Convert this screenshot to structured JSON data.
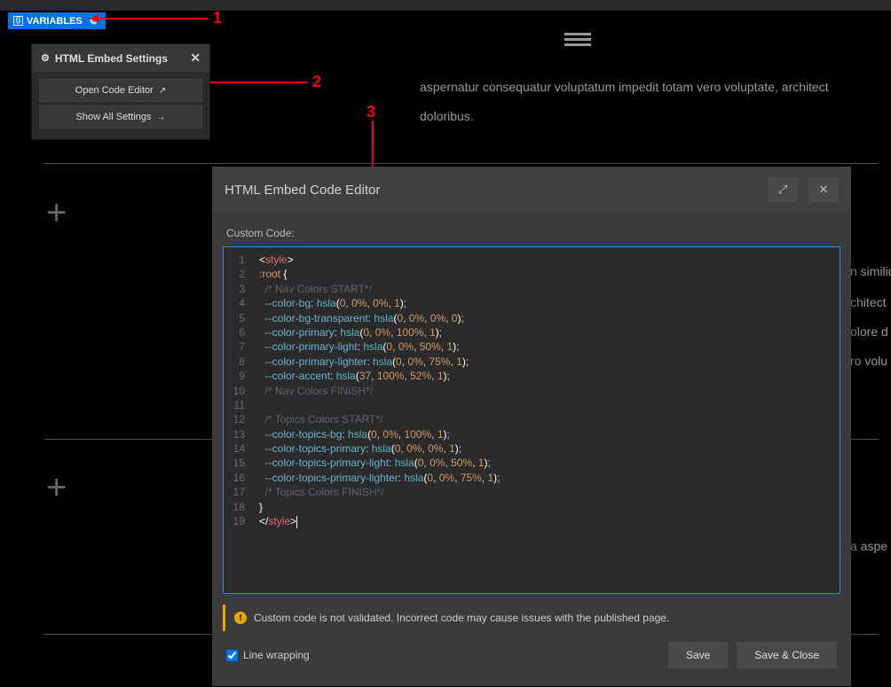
{
  "variables": {
    "label": "VARIABLES"
  },
  "annotations": {
    "n1": "1",
    "n2": "2",
    "n3": "3"
  },
  "settings": {
    "title": "HTML Embed Settings",
    "open_code": "Open Code Editor",
    "show_all": "Show All Settings"
  },
  "bg": {
    "line1": "aspernatur consequatur voluptatum impedit totam vero voluptate, architect",
    "line2": "doloribus.",
    "line3": "n similiq",
    "line4": "chitect",
    "line5": "olore d",
    "line6": "ro volu",
    "line7": "a aspe"
  },
  "editor": {
    "title": "HTML Embed Code Editor",
    "custom_label": "Custom Code:",
    "warning": "Custom code is not validated. Incorrect code may cause issues with the published page.",
    "line_wrap": "Line wrapping",
    "save": "Save",
    "save_close": "Save & Close",
    "lines": [
      {
        "n": 1,
        "tokens": [
          [
            "bracket",
            "<"
          ],
          [
            "tag",
            "style"
          ],
          [
            "bracket",
            ">"
          ]
        ]
      },
      {
        "n": 2,
        "tokens": [
          [
            "sel",
            ":root "
          ],
          [
            "bracket",
            "{"
          ]
        ]
      },
      {
        "n": 3,
        "tokens": [
          [
            "plain",
            "  "
          ],
          [
            "comment",
            "/* Nav Colors START*/"
          ]
        ]
      },
      {
        "n": 4,
        "tokens": [
          [
            "plain",
            "  "
          ],
          [
            "var",
            "--color-bg"
          ],
          [
            "plain",
            ": "
          ],
          [
            "func",
            "hsla"
          ],
          [
            "bracket",
            "("
          ],
          [
            "num",
            "0"
          ],
          [
            "plain",
            ", "
          ],
          [
            "num",
            "0%"
          ],
          [
            "plain",
            ", "
          ],
          [
            "num",
            "0%"
          ],
          [
            "plain",
            ", "
          ],
          [
            "num",
            "1"
          ],
          [
            "bracket",
            ")"
          ],
          [
            "plain",
            ";"
          ]
        ]
      },
      {
        "n": 5,
        "tokens": [
          [
            "plain",
            "  "
          ],
          [
            "var",
            "--color-bg-transparent"
          ],
          [
            "plain",
            ": "
          ],
          [
            "func",
            "hsla"
          ],
          [
            "bracket",
            "("
          ],
          [
            "num",
            "0"
          ],
          [
            "plain",
            ", "
          ],
          [
            "num",
            "0%"
          ],
          [
            "plain",
            ", "
          ],
          [
            "num",
            "0%"
          ],
          [
            "plain",
            ", "
          ],
          [
            "num",
            "0"
          ],
          [
            "bracket",
            ")"
          ],
          [
            "plain",
            ";"
          ]
        ]
      },
      {
        "n": 6,
        "tokens": [
          [
            "plain",
            "  "
          ],
          [
            "var",
            "--color-primary"
          ],
          [
            "plain",
            ": "
          ],
          [
            "func",
            "hsla"
          ],
          [
            "bracket",
            "("
          ],
          [
            "num",
            "0"
          ],
          [
            "plain",
            ", "
          ],
          [
            "num",
            "0%"
          ],
          [
            "plain",
            ", "
          ],
          [
            "num",
            "100%"
          ],
          [
            "plain",
            ", "
          ],
          [
            "num",
            "1"
          ],
          [
            "bracket",
            ")"
          ],
          [
            "plain",
            ";"
          ]
        ]
      },
      {
        "n": 7,
        "tokens": [
          [
            "plain",
            "  "
          ],
          [
            "var",
            "--color-primary-light"
          ],
          [
            "plain",
            ": "
          ],
          [
            "func",
            "hsla"
          ],
          [
            "bracket",
            "("
          ],
          [
            "num",
            "0"
          ],
          [
            "plain",
            ", "
          ],
          [
            "num",
            "0%"
          ],
          [
            "plain",
            ", "
          ],
          [
            "num",
            "50%"
          ],
          [
            "plain",
            ", "
          ],
          [
            "num",
            "1"
          ],
          [
            "bracket",
            ")"
          ],
          [
            "plain",
            ";"
          ]
        ]
      },
      {
        "n": 8,
        "tokens": [
          [
            "plain",
            "  "
          ],
          [
            "var",
            "--color-primary-lighter"
          ],
          [
            "plain",
            ": "
          ],
          [
            "func",
            "hsla"
          ],
          [
            "bracket",
            "("
          ],
          [
            "num",
            "0"
          ],
          [
            "plain",
            ", "
          ],
          [
            "num",
            "0%"
          ],
          [
            "plain",
            ", "
          ],
          [
            "num",
            "75%"
          ],
          [
            "plain",
            ", "
          ],
          [
            "num",
            "1"
          ],
          [
            "bracket",
            ")"
          ],
          [
            "plain",
            ";"
          ]
        ]
      },
      {
        "n": 9,
        "tokens": [
          [
            "plain",
            "  "
          ],
          [
            "var",
            "--color-accent"
          ],
          [
            "plain",
            ": "
          ],
          [
            "func",
            "hsla"
          ],
          [
            "bracket",
            "("
          ],
          [
            "num",
            "37"
          ],
          [
            "plain",
            ", "
          ],
          [
            "num",
            "100%"
          ],
          [
            "plain",
            ", "
          ],
          [
            "num",
            "52%"
          ],
          [
            "plain",
            ", "
          ],
          [
            "num",
            "1"
          ],
          [
            "bracket",
            ")"
          ],
          [
            "plain",
            ";"
          ]
        ]
      },
      {
        "n": 10,
        "tokens": [
          [
            "plain",
            "  "
          ],
          [
            "comment",
            "/* Nav Colors FINISH*/"
          ]
        ]
      },
      {
        "n": 11,
        "tokens": []
      },
      {
        "n": 12,
        "tokens": [
          [
            "plain",
            "  "
          ],
          [
            "comment",
            "/* Topics Colors START*/"
          ]
        ]
      },
      {
        "n": 13,
        "tokens": [
          [
            "plain",
            "  "
          ],
          [
            "var",
            "--color-topics-bg"
          ],
          [
            "plain",
            ": "
          ],
          [
            "func",
            "hsla"
          ],
          [
            "bracket",
            "("
          ],
          [
            "num",
            "0"
          ],
          [
            "plain",
            ", "
          ],
          [
            "num",
            "0%"
          ],
          [
            "plain",
            ", "
          ],
          [
            "num",
            "100%"
          ],
          [
            "plain",
            ", "
          ],
          [
            "num",
            "1"
          ],
          [
            "bracket",
            ")"
          ],
          [
            "plain",
            ";"
          ]
        ]
      },
      {
        "n": 14,
        "tokens": [
          [
            "plain",
            "  "
          ],
          [
            "var",
            "--color-topics-primary"
          ],
          [
            "plain",
            ": "
          ],
          [
            "func",
            "hsla"
          ],
          [
            "bracket",
            "("
          ],
          [
            "num",
            "0"
          ],
          [
            "plain",
            ", "
          ],
          [
            "num",
            "0%"
          ],
          [
            "plain",
            ", "
          ],
          [
            "num",
            "0%"
          ],
          [
            "plain",
            ", "
          ],
          [
            "num",
            "1"
          ],
          [
            "bracket",
            ")"
          ],
          [
            "plain",
            ";"
          ]
        ]
      },
      {
        "n": 15,
        "tokens": [
          [
            "plain",
            "  "
          ],
          [
            "var",
            "--color-topics-primary-light"
          ],
          [
            "plain",
            ": "
          ],
          [
            "func",
            "hsla"
          ],
          [
            "bracket",
            "("
          ],
          [
            "num",
            "0"
          ],
          [
            "plain",
            ", "
          ],
          [
            "num",
            "0%"
          ],
          [
            "plain",
            ", "
          ],
          [
            "num",
            "50%"
          ],
          [
            "plain",
            ", "
          ],
          [
            "num",
            "1"
          ],
          [
            "bracket",
            ")"
          ],
          [
            "plain",
            ";"
          ]
        ]
      },
      {
        "n": 16,
        "tokens": [
          [
            "plain",
            "  "
          ],
          [
            "var",
            "--color-topics-primary-lighter"
          ],
          [
            "plain",
            ": "
          ],
          [
            "func",
            "hsla"
          ],
          [
            "bracket",
            "("
          ],
          [
            "num",
            "0"
          ],
          [
            "plain",
            ", "
          ],
          [
            "num",
            "0%"
          ],
          [
            "plain",
            ", "
          ],
          [
            "num",
            "75%"
          ],
          [
            "plain",
            ", "
          ],
          [
            "num",
            "1"
          ],
          [
            "bracket",
            ")"
          ],
          [
            "plain",
            ";"
          ]
        ]
      },
      {
        "n": 17,
        "tokens": [
          [
            "plain",
            "  "
          ],
          [
            "comment",
            "/* Topics Colors FINISH*/"
          ]
        ]
      },
      {
        "n": 18,
        "tokens": [
          [
            "bracket",
            "}"
          ]
        ]
      },
      {
        "n": 19,
        "tokens": [
          [
            "bracket",
            "</"
          ],
          [
            "tag",
            "style"
          ],
          [
            "bracket",
            ">"
          ]
        ],
        "cursor": true
      }
    ]
  }
}
